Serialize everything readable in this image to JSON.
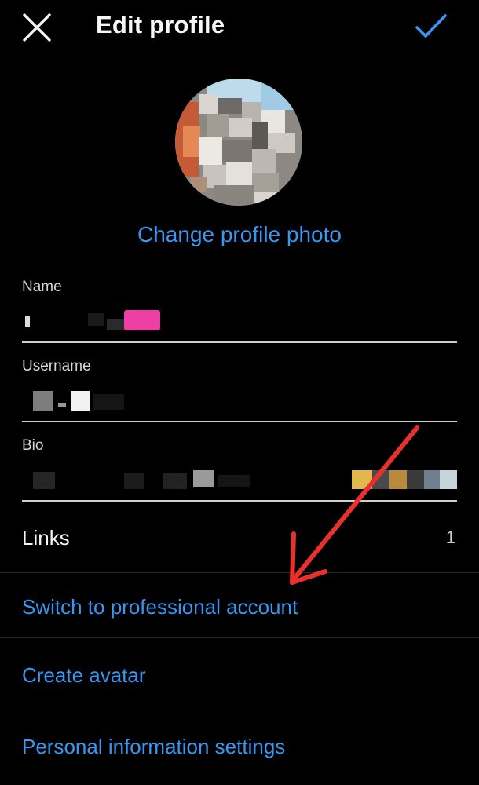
{
  "header": {
    "title": "Edit profile",
    "close_icon": "close-icon",
    "confirm_icon": "checkmark-icon",
    "accent_color": "#3897f0"
  },
  "profile_photo": {
    "change_label": "Change profile photo"
  },
  "fields": {
    "name": {
      "label": "Name"
    },
    "username": {
      "label": "Username"
    },
    "bio": {
      "label": "Bio"
    }
  },
  "links": {
    "label": "Links",
    "count": "1"
  },
  "actions": {
    "switch_professional": "Switch to professional account",
    "create_avatar": "Create avatar",
    "personal_info": "Personal information settings"
  },
  "annotation": {
    "arrow_color": "#e8312d"
  }
}
